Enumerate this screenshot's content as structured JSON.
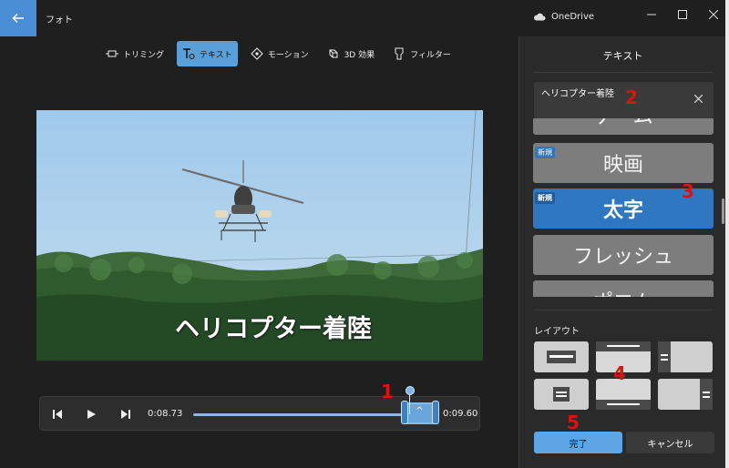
{
  "window": {
    "title": "フォト",
    "onedrive_label": "OneDrive"
  },
  "toolbar": {
    "tools": [
      {
        "label": "トリミング",
        "icon": "trim-icon",
        "active": false
      },
      {
        "label": "テキスト",
        "icon": "text-icon",
        "active": true
      },
      {
        "label": "モーション",
        "icon": "motion-icon",
        "active": false
      },
      {
        "label": "3D 効果",
        "icon": "3d-effects-icon",
        "active": false
      },
      {
        "label": "フィルター",
        "icon": "filter-icon",
        "active": false
      }
    ]
  },
  "video": {
    "overlay_text": "ヘリコプター着陸"
  },
  "playback": {
    "start_time": "0:08.73",
    "end_time": "0:09.60"
  },
  "panel": {
    "title": "テキスト",
    "text_value": "ヘリコプター着陸",
    "styles": [
      {
        "label": "ゲーム",
        "badge": ""
      },
      {
        "label": "映画",
        "badge": "新規"
      },
      {
        "label": "太字",
        "badge": "新規",
        "selected": true
      },
      {
        "label": "フレッシュ",
        "badge": ""
      },
      {
        "label": "ポエム",
        "badge": ""
      }
    ],
    "layout_title": "レイアウト",
    "done_label": "完了",
    "cancel_label": "キャンセル"
  },
  "annotations": [
    "1",
    "2",
    "3",
    "4",
    "5"
  ],
  "colors": {
    "accent": "#5ea5e4",
    "selected_style": "#2f77c0",
    "annotation": "#e01010"
  }
}
